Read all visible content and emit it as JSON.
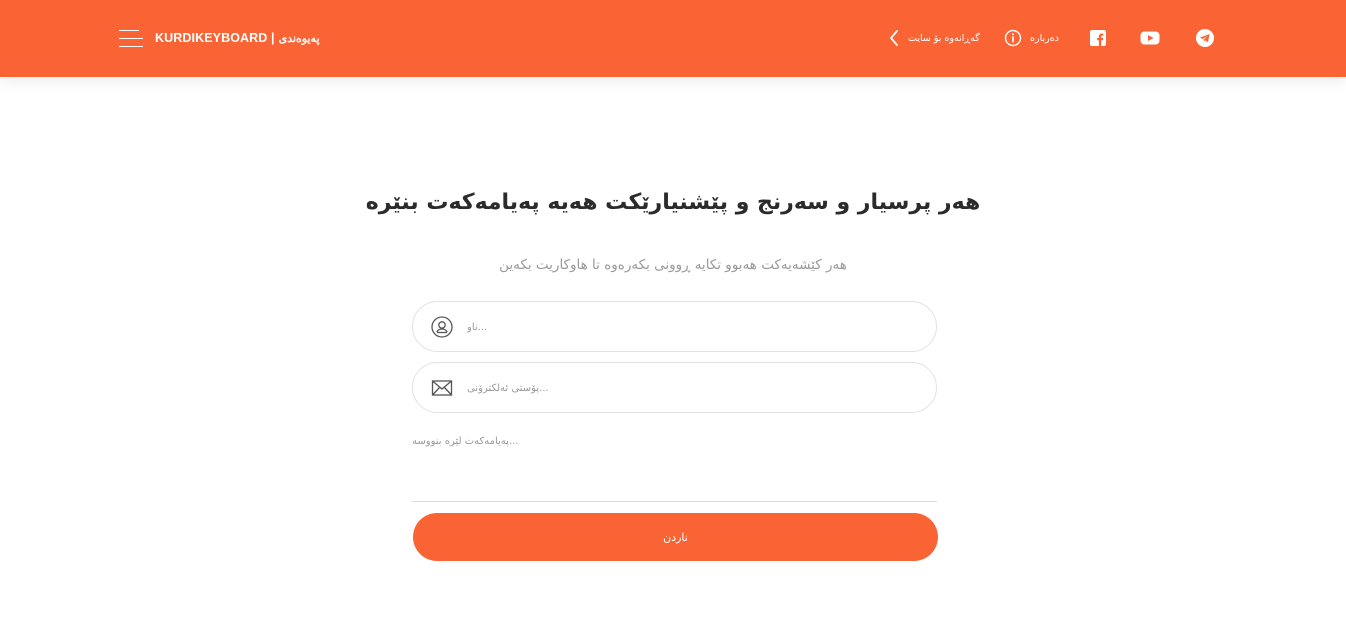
{
  "header": {
    "brand": "KURDIKEYBOARD |",
    "brand_sub": "پەیوەندی",
    "back_label": "گەڕانەوە بۆ سایت",
    "about_label": "دەربارە",
    "background_color": "#fa6434",
    "icons": {
      "menu": "hamburger-icon",
      "back": "chevron-left-icon",
      "about": "info-icon",
      "facebook": "facebook-icon",
      "youtube": "youtube-icon",
      "telegram": "telegram-icon"
    }
  },
  "main": {
    "title": "هەر پرسیار و سەرنج و پێشنیارێکت هەیە پەیامەکەت بنێرە",
    "subtitle": "هەر کێشەیەکت هەبوو تکایە ڕوونی بکەرەوە تا هاوکاریت بکەین",
    "form": {
      "name_placeholder": "ناو...",
      "email_placeholder": "پۆستی ئەلکترۆنی...",
      "message_placeholder": "پەیامەکەت لێرە بنووسە...",
      "submit_label": "ناردن",
      "accent_color": "#fa6434"
    }
  }
}
